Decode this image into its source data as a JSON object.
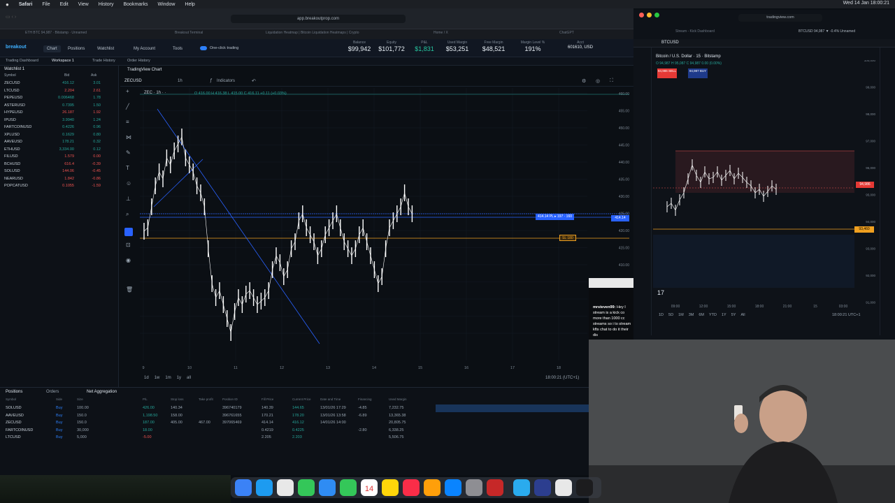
{
  "menubar": {
    "apple": "",
    "app": "Safari",
    "items": [
      "File",
      "Edit",
      "View",
      "History",
      "Bookmarks",
      "Window",
      "Help"
    ],
    "right_time": "Wed 14 Jan 18:00:21"
  },
  "browser_left": {
    "url": "app.breakoutprop.com",
    "tabs": [
      "ETH BTC 94,987 · Bitstamp · Unnamed",
      "Breakout Terminal",
      "Liquidation Heatmap | Bitcoin Liquidation Heatmaps | Crypto",
      "Home / X",
      "ChatGPT"
    ]
  },
  "browser_right": {
    "url": "tradingview.com",
    "tabs": [
      "Stream - Kick Dashboard",
      "BTCUSD 94,987 ▼ -0.4% Unnamed"
    ]
  },
  "app": {
    "logo": "breakout",
    "nav": [
      "Chart",
      "Positions",
      "Watchlist"
    ],
    "account_btn": "My Account",
    "tools_btn": "Tools",
    "one_click": "One-click trading",
    "subnav": [
      "Trading Dashboard",
      "Workspace 1",
      "Trade History",
      "Order History"
    ],
    "stats": [
      {
        "label": "Balance",
        "value": "$99,942"
      },
      {
        "label": "Equity",
        "value": "$101,772"
      },
      {
        "label": "P&L",
        "value": "$1,831"
      },
      {
        "label": "Used Margin",
        "value": "$53,251"
      },
      {
        "label": "Free Margin",
        "value": "$48,521"
      },
      {
        "label": "Margin Level %",
        "value": "191%"
      },
      {
        "label": "Acct",
        "value": "601610, USD"
      }
    ]
  },
  "watchlist": {
    "title": "Watchlist 1",
    "headers": [
      "Symbol",
      "Bid",
      "Ask"
    ],
    "rows": [
      {
        "sym": "ZECUSD",
        "bid": "416.12",
        "ask": "3.01",
        "c": "#26a69a"
      },
      {
        "sym": "LTCUSD",
        "bid": "2.204",
        "ask": "2.61",
        "c": "#ef5350"
      },
      {
        "sym": "PEPEUSD",
        "bid": "0.006468",
        "ask": "1.78",
        "c": "#26a69a"
      },
      {
        "sym": "ASTERUSD",
        "bid": "0.7395",
        "ask": "1.50",
        "c": "#26a69a"
      },
      {
        "sym": "HYPEUSD",
        "bid": "26.187",
        "ask": "1.92",
        "c": "#ef5350"
      },
      {
        "sym": "IPUSD",
        "bid": "3.9940",
        "ask": "1.24",
        "c": "#26a69a"
      },
      {
        "sym": "FARTCOINUSD",
        "bid": "0.4226",
        "ask": "0.96",
        "c": "#26a69a"
      },
      {
        "sym": "XPLUSD",
        "bid": "0.1629",
        "ask": "0.80",
        "c": "#26a69a"
      },
      {
        "sym": "AAVEUSD",
        "bid": "178.21",
        "ask": "0.32",
        "c": "#26a69a"
      },
      {
        "sym": "ETHUSD",
        "bid": "3,334.00",
        "ask": "0.12",
        "c": "#26a69a"
      },
      {
        "sym": "FILUSD",
        "bid": "1.579",
        "ask": "0.00",
        "c": "#ef5350"
      },
      {
        "sym": "BCHUSD",
        "bid": "616.4",
        "ask": "-0.39",
        "c": "#ef5350"
      },
      {
        "sym": "SOLUSD",
        "bid": "144.06",
        "ask": "-0.45",
        "c": "#ef5350"
      },
      {
        "sym": "NEARUSD",
        "bid": "1.842",
        "ask": "-0.86",
        "c": "#ef5350"
      },
      {
        "sym": "POPCATUSD",
        "bid": "0.1055",
        "ask": "-1.59",
        "c": "#ef5350"
      }
    ]
  },
  "chart": {
    "panel_title": "TradingView Chart",
    "symbol": "ZECUSD",
    "interval": "1h",
    "indicators": "Indicators",
    "legend": "ZEC · 1h · ·",
    "ohlc": "O 416.00 H 416.38 L 415.00 C 416.11 +0.11 (+0.03%)",
    "pos_label": "414.14 PL ▸ 197 · 160",
    "sl_label": "SL 180",
    "price_marker": "414.14",
    "time_label": "18:00:21 (UTC+1)",
    "ranges": [
      "1d",
      "1w",
      "1m",
      "1y",
      "all"
    ],
    "x_ticks": [
      "9",
      "10",
      "11",
      "12",
      "13",
      "14",
      "15",
      "16",
      "17",
      "18"
    ],
    "y_ticks": [
      "460.00",
      "455.00",
      "450.00",
      "445.00",
      "440.00",
      "435.00",
      "430.00",
      "425.00",
      "420.00",
      "415.00",
      "410.00",
      "405.00",
      "400.00",
      "395.00",
      "390.00"
    ],
    "colors": {
      "up": "#ffffff",
      "line": "#2962ff",
      "sl": "#f0a020"
    }
  },
  "positions": {
    "tabs": [
      "Positions",
      "Orders",
      "Net Aggregation"
    ],
    "headers": [
      "Symbol",
      "Side",
      "Size",
      "P/L",
      "Stop loss",
      "Take profit",
      "Position ID",
      "Fill Price",
      "Current Price",
      "Date and Time",
      "Financing",
      "Used Margin"
    ],
    "rows": [
      {
        "sym": "SOLUSD",
        "side": "Buy",
        "size": "100.00",
        "pl": "426.00",
        "sl": "140.34",
        "tp": "",
        "pid": "396740179",
        "fill": "140.39",
        "cur": "144.65",
        "dt": "13/01/26 17:29",
        "fin": "-4.85",
        "um": "7,232.75"
      },
      {
        "sym": "AAVEUSD",
        "side": "Buy",
        "size": "150.0",
        "pl": "1,198.50",
        "sl": "158.00",
        "tp": "",
        "pid": "396761655",
        "fill": "170.21",
        "cur": "178.20",
        "dt": "13/01/26 13:58",
        "fin": "-6.89",
        "um": "13,365.38"
      },
      {
        "sym": "ZECUSD",
        "side": "Buy",
        "size": "150.0",
        "pl": "187.00",
        "sl": "405.00",
        "tp": "467.00",
        "pid": "397065469",
        "fill": "414.14",
        "cur": "416.12",
        "dt": "14/01/26 14:00",
        "fin": "",
        "um": "20,805.75"
      },
      {
        "sym": "FARTCOINUSD",
        "side": "Buy",
        "size": "30,000",
        "pl": "18.00",
        "sl": "",
        "tp": "",
        "pid": "",
        "fill": "0.4219",
        "cur": "0.4225",
        "dt": "",
        "fin": "-2.80",
        "um": "6,338.25"
      },
      {
        "sym": "LTCUSD",
        "side": "Buy",
        "size": "5,000",
        "pl": "-5.00",
        "sl": "",
        "tp": "",
        "pid": "",
        "fill": "2.205",
        "cur": "2.203",
        "dt": "",
        "fin": "",
        "um": "5,506.75"
      }
    ]
  },
  "rchart": {
    "title": "Bitcoin / U.S. Dollar · 15 · Bitstamp",
    "ohlc": "O 94,987 H 95,087 C 94,987 0.00 (0.00%)",
    "symbol": "BTCUSD",
    "sell": "94,986 SELL",
    "buy": "94,987 BUY",
    "price_tag": "94,986",
    "level_tag": "93,460",
    "x_ticks": [
      "09:00",
      "12:00",
      "15:00",
      "18:00",
      "21:00",
      "15",
      "03:00"
    ],
    "y_ticks": [
      "100,000",
      "99,000",
      "98,000",
      "97,000",
      "96,000",
      "95,000",
      "94,000",
      "93,000",
      "92,000",
      "91,000"
    ],
    "ranges": [
      "1D",
      "5D",
      "1M",
      "3M",
      "6M",
      "YTD",
      "1Y",
      "5Y",
      "All"
    ],
    "time": "18:00:21 UTC+1"
  },
  "chat": {
    "user": "mrsteven99:",
    "text": "Hey I stream is a kick co more than 1000 cc streams so i to stream kfts chat to do it their dis"
  },
  "dock": {
    "date": "14"
  }
}
